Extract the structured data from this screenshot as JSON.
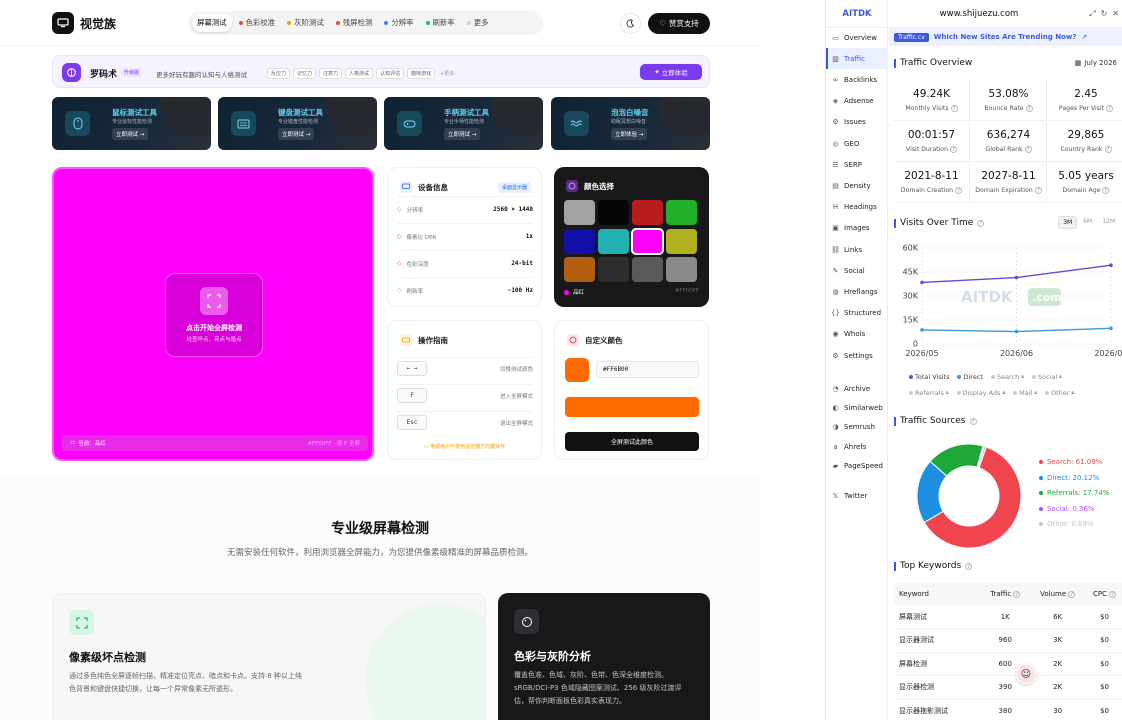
{
  "site": {
    "logo_text": "视觉族",
    "nav": [
      {
        "label": "屏幕测试",
        "color": ""
      },
      {
        "label": "色彩校准",
        "color": "#ef4444"
      },
      {
        "label": "灰阶测试",
        "color": "#f59e0b"
      },
      {
        "label": "残屏检测",
        "color": "#ef4444"
      },
      {
        "label": "分辨率",
        "color": "#3b82f6"
      },
      {
        "label": "刷新率",
        "color": "#10b981"
      },
      {
        "label": "更多",
        "color": "#d1d5db"
      }
    ],
    "support_label": "赞赏支持",
    "banner": {
      "title": "罗码术",
      "badge": "升级版",
      "desc": "更多好玩有趣的认知与人格测试",
      "tags": [
        "反应力",
        "记忆力",
        "注意力",
        "人格测试",
        "认知评估",
        "趣味游戏"
      ],
      "more": "+更多",
      "button": "立即体验"
    },
    "tools": [
      {
        "title": "鼠标测试工具",
        "desc": "专业鼠标性能检测",
        "button": "立即测试",
        "icon": "mouse-icon"
      },
      {
        "title": "键盘测试工具",
        "desc": "专业键盘性能检测",
        "button": "立即测试",
        "icon": "keyboard-icon"
      },
      {
        "title": "手柄测试工具",
        "desc": "专业手柄性能检测",
        "button": "立即测试",
        "icon": "gamepad-icon"
      },
      {
        "title": "泡泡白噪音",
        "desc": "助眠冥想白噪音",
        "button": "立即体验",
        "icon": "waves-icon"
      }
    ],
    "fullscreen": {
      "title": "点击开始全屏检测",
      "sub": "检查坏点、亮点与暗点",
      "current_label": "当前：品红",
      "hex_hint": "#FF00FF · 按 F 全屏"
    },
    "device": {
      "title": "设备信息",
      "badge": "桌面显示器",
      "rows": [
        {
          "k": "分辨率",
          "v": "2560 × 1440"
        },
        {
          "k": "像素比 DPR",
          "v": "1x"
        },
        {
          "k": "色彩深度",
          "v": "24-bit"
        },
        {
          "k": "刷新率",
          "v": "~100 Hz"
        }
      ]
    },
    "colors": {
      "title": "颜色选择",
      "swatches": [
        "#a3a3a3",
        "#050505",
        "#b91c1c",
        "#22b02a",
        "#1010a8",
        "#22b0b0",
        "#ff00ff",
        "#b0b020",
        "#b45f10",
        "#2e2e2e",
        "#5a5a5a",
        "#8a8a8a"
      ],
      "selected_label": "品红",
      "selected_hex": "#FF00FF"
    },
    "guide": {
      "title": "操作指南",
      "rows": [
        {
          "key": "← →",
          "desc": "切换测试颜色"
        },
        {
          "key": "F",
          "desc": "进入全屏模式"
        },
        {
          "key": "Esc",
          "desc": "退出全屏模式"
        }
      ],
      "note": "电视用户可使用遥控器方向键操作"
    },
    "custom": {
      "title": "自定义颜色",
      "hex_value": "#FF6B00",
      "button": "全屏测试此颜色",
      "color": "#ff6b00"
    },
    "section": {
      "title": "专业级屏幕检测",
      "sub": "无需安装任何软件，利用浏览器全屏能力，为您提供像素级精准的屏幕品质检测。"
    },
    "features": [
      {
        "title": "像素级坏点检测",
        "desc": "通过多色纯色全屏逐帧扫描，精准定位亮点、暗点和卡点。支持 8 种以上纯色背景和键盘快捷切换，让每一个异常像素无所遁形。"
      },
      {
        "title": "色彩与灰阶分析",
        "desc": "覆盖色准、色域、灰阶、色带、色深全维度检测。sRGB/DCI-P3 色域隐藏图案测试、256 级灰阶过渡评估，帮你判断面板色彩真实表现力。"
      }
    ]
  },
  "ext": {
    "brand": "AITDK",
    "url": "www.shijuezu.com",
    "sidebar": [
      {
        "label": "Overview",
        "icon": "chart-icon",
        "active": false
      },
      {
        "label": "Traffic",
        "icon": "traffic-icon",
        "active": true
      },
      {
        "label": "Backlinks",
        "icon": "link-icon",
        "active": false
      },
      {
        "label": "Adsense",
        "icon": "adsense-icon",
        "active": false
      },
      {
        "label": "Issues",
        "icon": "issues-icon",
        "active": false
      },
      {
        "label": "GEO",
        "icon": "geo-icon",
        "active": false
      },
      {
        "label": "SERP",
        "icon": "serp-icon",
        "active": false
      },
      {
        "label": "Density",
        "icon": "density-icon",
        "active": false
      },
      {
        "label": "Headings",
        "icon": "headings-icon",
        "active": false
      },
      {
        "label": "Images",
        "icon": "images-icon",
        "active": false
      },
      {
        "label": "Links",
        "icon": "links-icon",
        "active": false
      },
      {
        "label": "Social",
        "icon": "social-icon",
        "active": false
      },
      {
        "label": "Hreflangs",
        "icon": "globe-icon",
        "active": false
      },
      {
        "label": "Structured",
        "icon": "braces-icon",
        "active": false
      },
      {
        "label": "Whois",
        "icon": "whois-icon",
        "active": false
      },
      {
        "label": "Settings",
        "icon": "gear-icon",
        "active": false
      },
      {
        "label": "Archive",
        "icon": "archive-icon",
        "active": false
      },
      {
        "label": "Similarweb",
        "icon": "similarweb-icon",
        "active": false
      },
      {
        "label": "Semrush",
        "icon": "semrush-icon",
        "active": false
      },
      {
        "label": "Ahrefs",
        "icon": "ahrefs-icon",
        "active": false
      },
      {
        "label": "PageSpeed",
        "icon": "pagespeed-icon",
        "active": false
      },
      {
        "label": "Twitter",
        "icon": "x-icon",
        "active": false
      }
    ],
    "promo": {
      "badge": "Traffic.cv",
      "text": "Which New Sites Are Trending Now?"
    },
    "overview": {
      "title": "Traffic Overview",
      "date": "July 2026",
      "stats": [
        {
          "v": "49.24K",
          "l": "Monthly Visits"
        },
        {
          "v": "53.08%",
          "l": "Bounce Rate"
        },
        {
          "v": "2.45",
          "l": "Pages Per Visit"
        },
        {
          "v": "00:01:57",
          "l": "Visit Duration"
        },
        {
          "v": "636,274",
          "l": "Global Rank"
        },
        {
          "v": "29,865",
          "l": "Country Rank"
        },
        {
          "v": "2021-8-11",
          "l": "Domain Creation"
        },
        {
          "v": "2027-8-11",
          "l": "Domain Expiration"
        },
        {
          "v": "5.05 years",
          "l": "Domain Age"
        }
      ]
    },
    "visits": {
      "title": "Visits Over Time",
      "ranges": [
        "3M",
        "6M",
        "12M"
      ],
      "watermark": "AITDK",
      "watermark2": ".com",
      "legend": [
        {
          "label": "Total Visits",
          "color": "#5b4fd6",
          "locked": false
        },
        {
          "label": "Direct",
          "color": "#3b9ad9",
          "locked": false
        },
        {
          "label": "Search",
          "color": "#cccccc",
          "locked": true
        },
        {
          "label": "Social",
          "color": "#cccccc",
          "locked": true
        },
        {
          "label": "Referrals",
          "color": "#cccccc",
          "locked": true
        },
        {
          "label": "Display Ads",
          "color": "#cccccc",
          "locked": true
        },
        {
          "label": "Mail",
          "color": "#cccccc",
          "locked": true
        },
        {
          "label": "Other",
          "color": "#cccccc",
          "locked": true
        }
      ]
    },
    "sources": {
      "title": "Traffic Sources",
      "items": [
        {
          "label": "Search: 61.09%",
          "value": 61.09,
          "color": "#f0454e"
        },
        {
          "label": "Direct: 20.12%",
          "value": 20.12,
          "color": "#1e8fe0"
        },
        {
          "label": "Referrals: 17.74%",
          "value": 17.74,
          "color": "#1ea83a"
        },
        {
          "label": "Social: 0.36%",
          "value": 0.36,
          "color": "#a855f7"
        },
        {
          "label": "Other: 0.69%",
          "value": 0.69,
          "color": "#c4c4c4"
        }
      ]
    },
    "keywords": {
      "title": "Top Keywords",
      "headers": [
        "Keyword",
        "Traffic",
        "Volume",
        "CPC"
      ],
      "rows": [
        [
          "屏幕测试",
          "1K",
          "6K",
          "$0"
        ],
        [
          "显示器测试",
          "960",
          "3K",
          "$0"
        ],
        [
          "屏幕检测",
          "600",
          "2K",
          "$0"
        ],
        [
          "显示器检测",
          "390",
          "2K",
          "$0"
        ],
        [
          "显示器拖影测试",
          "380",
          "30",
          "$0"
        ]
      ]
    }
  },
  "chart_data": [
    {
      "type": "line",
      "x": [
        "2026/05",
        "2026/06",
        "2026/07"
      ],
      "ylim": [
        0,
        60000
      ],
      "yticks": [
        "0",
        "15K",
        "30K",
        "45K",
        "60K"
      ],
      "series": [
        {
          "name": "Total Visits",
          "values": [
            38500,
            41500,
            49240
          ],
          "color": "#5b4fd6"
        },
        {
          "name": "Direct",
          "values": [
            8800,
            7800,
            9800
          ],
          "color": "#3b9ad9"
        }
      ]
    },
    {
      "type": "pie",
      "categories": [
        "Search",
        "Direct",
        "Referrals",
        "Social",
        "Other"
      ],
      "values": [
        61.09,
        20.12,
        17.74,
        0.36,
        0.69
      ]
    }
  ]
}
